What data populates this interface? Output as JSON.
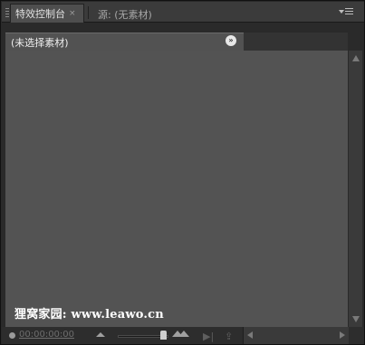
{
  "tabs": {
    "active_label": "特效控制台",
    "close_symbol": "×",
    "inactive_label": "源: (无素材)"
  },
  "header": {
    "clip_label": "(未选择素材)",
    "go_symbol": "»"
  },
  "content": {
    "watermark": "狸窝家园: www.leawo.cn"
  },
  "bottom": {
    "timecode": "00:00:00:00",
    "zoom_level": 0.85
  },
  "icons": [
    "grip-icon",
    "panel-menu-icon",
    "go-forward-icon",
    "scroll-up-icon",
    "scroll-down-icon",
    "scroll-left-icon",
    "scroll-right-icon",
    "zoom-out-icon",
    "zoom-in-icon",
    "timecode-dot-icon",
    "step-icon",
    "export-icon"
  ],
  "colors": {
    "panel_bg": "#535353",
    "tab_active_bg": "#4e4e4e",
    "header_bg": "#525252",
    "chrome_bg": "#3b3b3b"
  }
}
